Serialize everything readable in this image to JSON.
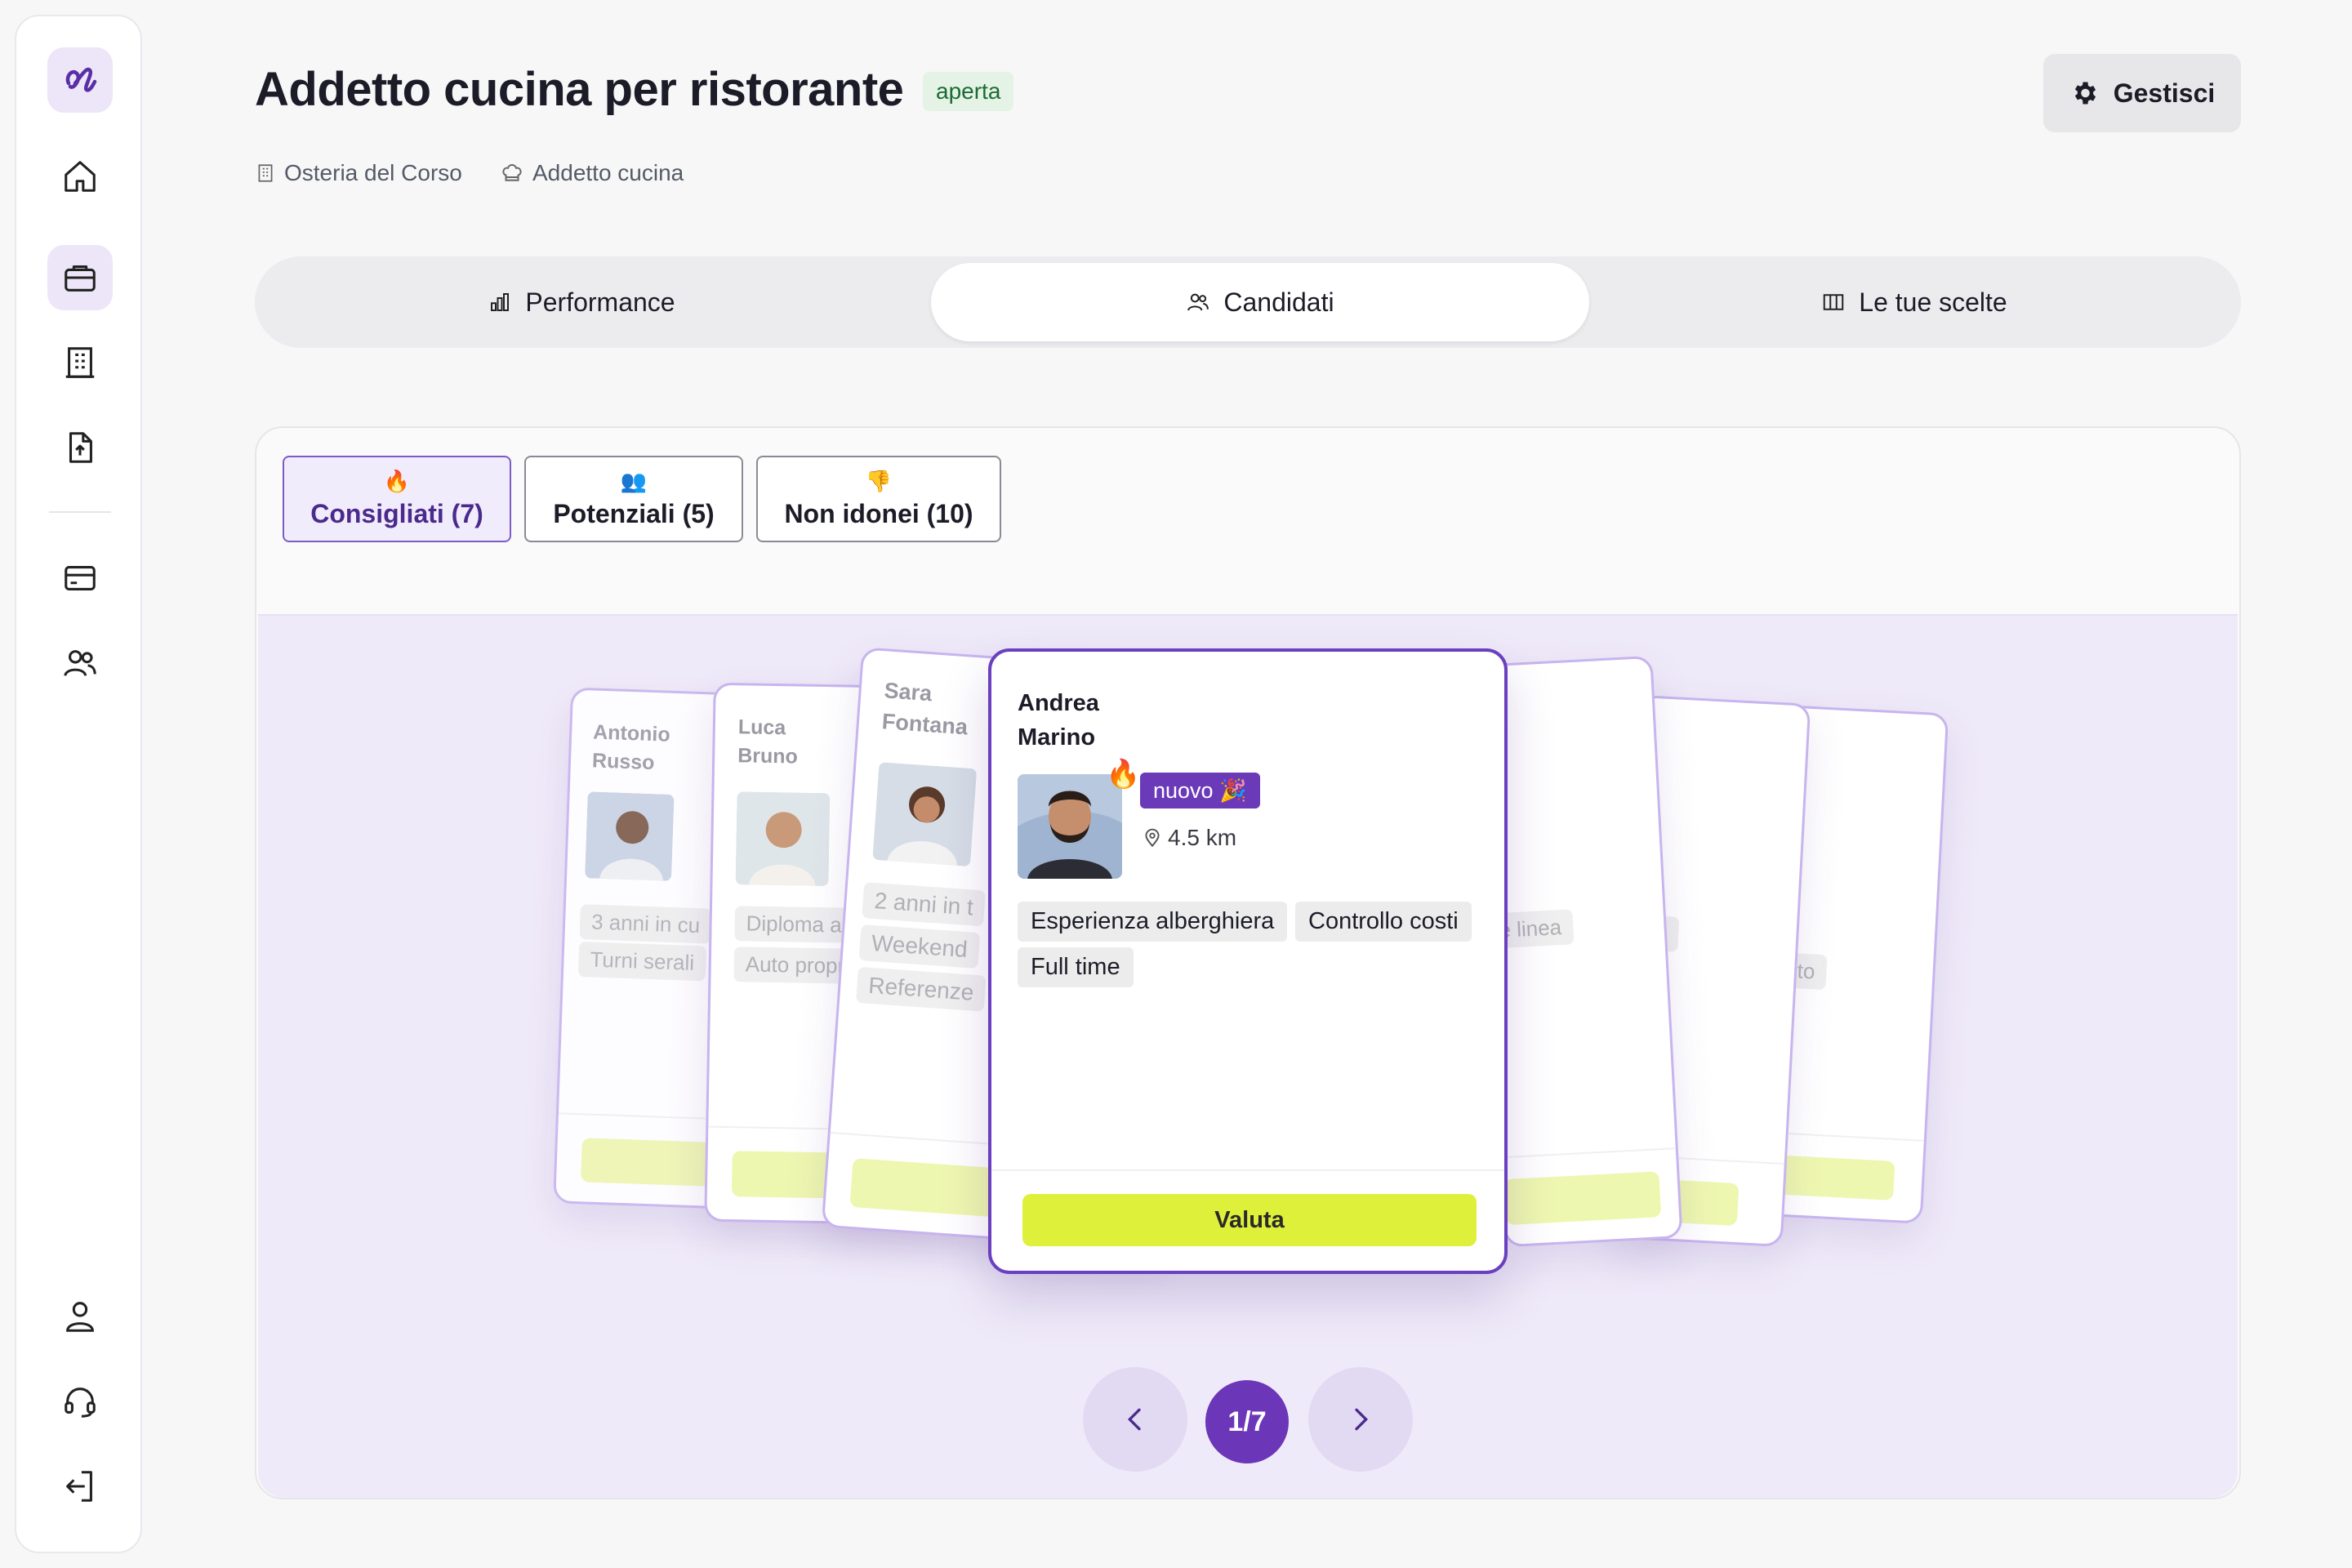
{
  "header": {
    "title": "Addetto cucina per ristorante",
    "status_badge": "aperta",
    "company": "Osteria del Corso",
    "role": "Addetto cucina",
    "manage_label": "Gestisci"
  },
  "tabs": [
    {
      "label": "Performance",
      "icon": "bar-chart-icon"
    },
    {
      "label": "Candidati",
      "icon": "users-icon",
      "active": true
    },
    {
      "label": "Le tue scelte",
      "icon": "columns-icon"
    }
  ],
  "filters": [
    {
      "emoji": "🔥",
      "label": "Consigliati (7)",
      "active": true
    },
    {
      "emoji": "👥",
      "label": "Potenziali (5)"
    },
    {
      "emoji": "👎",
      "label": "Non idonei (10)"
    }
  ],
  "sidebar": {
    "items": [
      "logo-icon",
      "home-icon",
      "briefcase-icon",
      "building-icon",
      "file-upload-icon",
      "credit-card-icon",
      "users-icon",
      "user-icon",
      "headset-icon",
      "logout-icon"
    ]
  },
  "cards": {
    "back": [
      {
        "first": "Antonio",
        "last": "Russo",
        "chips": [
          "3 anni in cu",
          "Turni serali"
        ]
      },
      {
        "first": "Luca",
        "last": "Bruno",
        "chips": [
          "Diploma alb",
          "Auto propr"
        ]
      },
      {
        "first": "Sara",
        "last": "Fontana",
        "chips": [
          "2 anni in t",
          "Weekend",
          "Referenze"
        ]
      }
    ],
    "right_fragments": [
      "e linea",
      "CP",
      "bito"
    ],
    "main": {
      "first": "Andrea",
      "last": "Marino",
      "badge": "nuovo 🎉",
      "distance": "4.5 km",
      "tags": [
        "Esperienza alberghiera",
        "Controllo costi",
        "Full time"
      ],
      "action_label": "Valuta",
      "fire_emoji": "🔥"
    }
  },
  "pager": {
    "position": "1/7"
  },
  "colors": {
    "accent": "#6b36b8",
    "lime": "#dff03a",
    "stage": "#efeaf9"
  }
}
